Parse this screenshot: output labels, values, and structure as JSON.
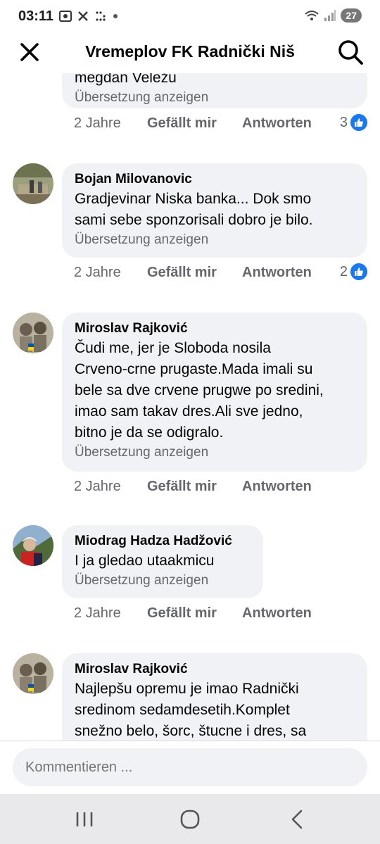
{
  "status": {
    "time": "03:11",
    "battery": "27",
    "left_icons": [
      "gallery-icon",
      "x-icon",
      "dots-grid-icon",
      "dot-icon"
    ],
    "right_icons": [
      "wifi-icon",
      "signal-icon",
      "battery-badge"
    ]
  },
  "header": {
    "title": "Vremeplov FK Radnički Niš",
    "close_icon": "close-icon",
    "search_icon": "search-icon"
  },
  "comments": [
    {
      "author": "",
      "text_lines": [
        "megdan Veležu"
      ],
      "translate": "Übersetzung anzeigen",
      "time": "2 Jahre",
      "like": "Gefällt mir",
      "reply": "Antworten",
      "reactions": "3"
    },
    {
      "author": "Bojan Milovanovic",
      "text_lines": [
        "Gradjevinar Niska banka... Dok smo",
        "sami sebe sponzorisali dobro je bilo."
      ],
      "translate": "Übersetzung anzeigen",
      "time": "2 Jahre",
      "like": "Gefällt mir",
      "reply": "Antworten",
      "reactions": "2"
    },
    {
      "author": "Miroslav Rajković",
      "text_lines": [
        "Čudi me, jer je Sloboda nosila",
        "Crveno-crne prugaste.Mada imali su",
        "bele sa dve crvene prugwe po sredini,",
        "imao sam takav dres.Ali sve jedno,",
        "bitno je da se odigralo."
      ],
      "translate": "Übersetzung anzeigen",
      "time": "2 Jahre",
      "like": "Gefällt mir",
      "reply": "Antworten",
      "reactions": ""
    },
    {
      "author": "Miodrag Hadza Hadžović",
      "text_lines": [
        "I ja gledao utaakmicu"
      ],
      "translate": "Übersetzung anzeigen",
      "time": "2 Jahre",
      "like": "Gefällt mir",
      "reply": "Antworten",
      "reactions": ""
    },
    {
      "author": "Miroslav Rajković",
      "text_lines": [
        "Najlepšu opremu je imao Radnički",
        "sredinom sedamdesetih.Komplet",
        "snežno belo, šorc, štucne i dres, sa"
      ],
      "translate": "",
      "time": "",
      "like": "",
      "reply": "",
      "reactions": ""
    }
  ],
  "composer": {
    "placeholder": "Kommentieren ..."
  },
  "navbar": {
    "icons": [
      "recent-apps-icon",
      "home-icon",
      "back-icon"
    ]
  },
  "colors": {
    "like_blue": "#1877f2",
    "bubble_bg": "#f0f2f5",
    "muted_text": "#65676b"
  }
}
